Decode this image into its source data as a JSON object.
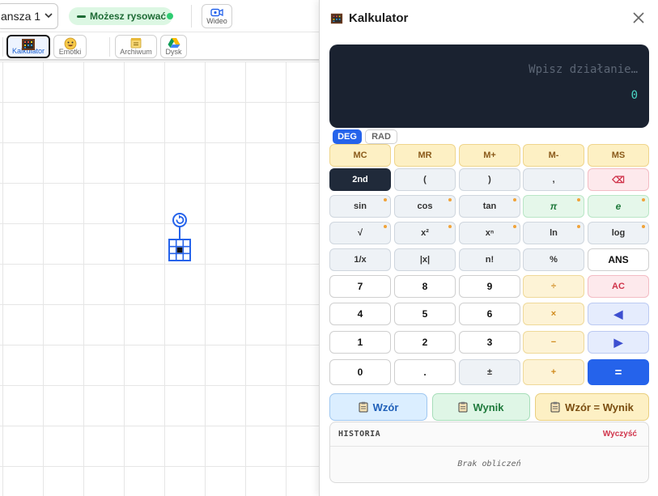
{
  "topbar": {
    "board_select_value": "ansza 1",
    "status_label": "Możesz rysować",
    "video_label": "Wideo"
  },
  "tools": {
    "calculator": "Kalkulator",
    "emoji": "Emotki",
    "archive": "Archiwum",
    "drive": "Dysk"
  },
  "panel": {
    "title": "Kalkulator",
    "display_placeholder": "Wpisz działanie…",
    "display_result": "0",
    "mode_deg": "DEG",
    "mode_rad": "RAD",
    "active_mode": "DEG"
  },
  "keys": {
    "row1": [
      "MC",
      "MR",
      "M+",
      "M-",
      "MS"
    ],
    "row2": [
      "2nd",
      "(",
      ")",
      ",",
      "⌫"
    ],
    "row3": [
      "sin",
      "cos",
      "tan",
      "π",
      "e"
    ],
    "row4": [
      "√",
      "x²",
      "xⁿ",
      "ln",
      "log"
    ],
    "row5": [
      "1/x",
      "|x|",
      "n!",
      "%",
      "ANS"
    ],
    "row6": [
      "7",
      "8",
      "9",
      "÷",
      "AC"
    ],
    "row7": [
      "4",
      "5",
      "6",
      "×",
      "◀"
    ],
    "row8": [
      "1",
      "2",
      "3",
      "−",
      "▶"
    ],
    "row9": [
      "0",
      ".",
      "±",
      "+",
      "="
    ]
  },
  "copy_buttons": {
    "formula": "Wzór",
    "result": "Wynik",
    "formula_result": "Wzór = Wynik"
  },
  "history": {
    "title": "HISTORIA",
    "clear_label": "Wyczyść",
    "empty_text": "Brak obliczeń"
  },
  "colors": {
    "accent": "#2563eb",
    "display_bg": "#1a2230",
    "result_text": "#4ad6c4",
    "status_green": "#2ecc71"
  }
}
